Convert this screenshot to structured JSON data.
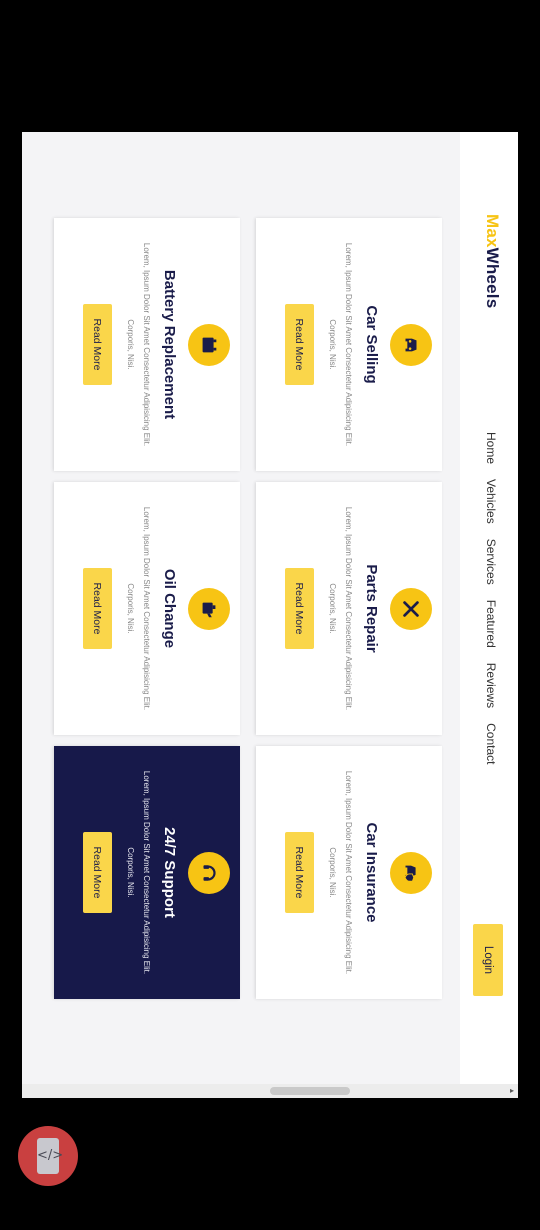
{
  "brand": {
    "accent": "Max",
    "rest": "Wheels"
  },
  "nav": {
    "items": [
      "Home",
      "Vehicles",
      "Services",
      "Featured",
      "Reviews",
      "Contact"
    ],
    "login": "Login"
  },
  "cards": [
    {
      "title": "Car Selling",
      "desc": "Lorem, Ipsum Dolor Sit Amet Consectetur Adipisicing Elit. Corporis, Nisi.",
      "button": "Read More",
      "icon": "car-icon"
    },
    {
      "title": "Parts Repair",
      "desc": "Lorem, Ipsum Dolor Sit Amet Consectetur Adipisicing Elit. Corporis, Nisi.",
      "button": "Read More",
      "icon": "tools-icon"
    },
    {
      "title": "Car Insurance",
      "desc": "Lorem, Ipsum Dolor Sit Amet Consectetur Adipisicing Elit. Corporis, Nisi.",
      "button": "Read More",
      "icon": "car-shield-icon"
    },
    {
      "title": "Battery Replacement",
      "desc": "Lorem, Ipsum Dolor Sit Amet Consectetur Adipisicing Elit. Corporis, Nisi.",
      "button": "Read More",
      "icon": "battery-icon"
    },
    {
      "title": "Oil Change",
      "desc": "Lorem, Ipsum Dolor Sit Amet Consectetur Adipisicing Elit. Corporis, Nisi.",
      "button": "Read More",
      "icon": "oil-can-icon"
    },
    {
      "title": "24/7 Support",
      "desc": "Lorem, Ipsum Dolor Sit Amet Consectetur Adipisicing Elit. Corporis, Nisi.",
      "button": "Read More",
      "icon": "headset-icon",
      "highlighted": true
    }
  ],
  "colors": {
    "accent": "#f7c414",
    "button": "#fad64a",
    "navy": "#17194a",
    "background": "#f4f4f6"
  }
}
